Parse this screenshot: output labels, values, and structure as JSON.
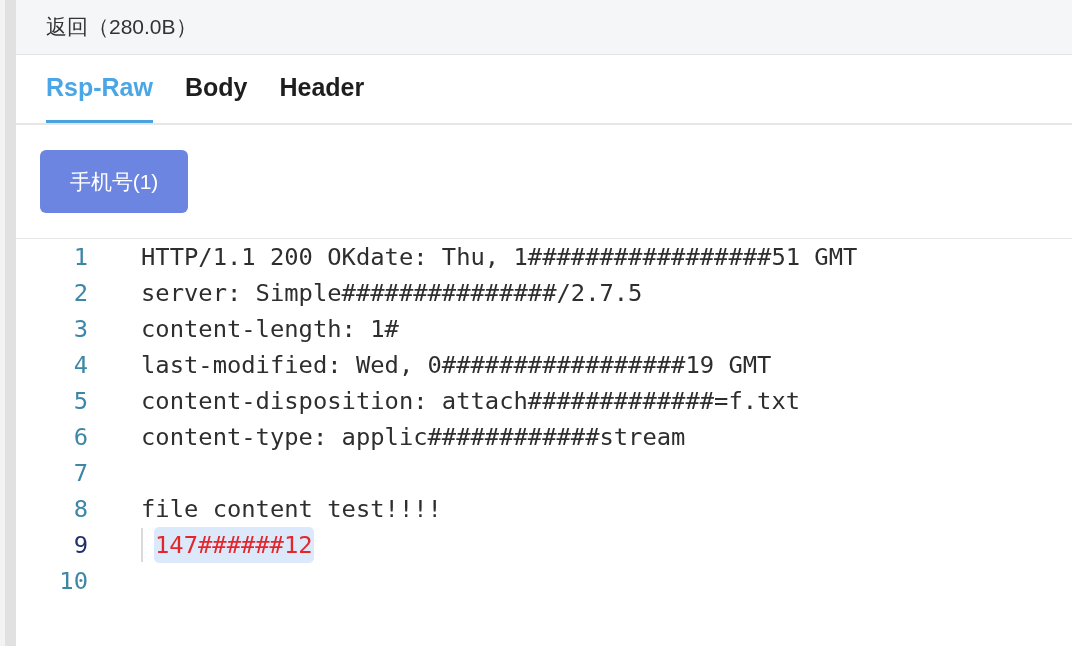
{
  "header": {
    "title": "返回（280.0B）"
  },
  "tabs": [
    {
      "label": "Rsp-Raw",
      "selected": true
    },
    {
      "label": "Body",
      "selected": false
    },
    {
      "label": "Header",
      "selected": false
    }
  ],
  "filters": [
    {
      "label": "手机号(1)"
    }
  ],
  "editor": {
    "lines": [
      {
        "number": "1",
        "kind": "plain",
        "text": "HTTP/1.1 200 OKdate: Thu, 1#################51 GMT",
        "active": false
      },
      {
        "number": "2",
        "kind": "plain",
        "text": "server: Simple###############/2.7.5",
        "active": false
      },
      {
        "number": "3",
        "kind": "plain",
        "text": "content-length: 1#",
        "active": false
      },
      {
        "number": "4",
        "kind": "plain",
        "text": "last-modified: Wed, 0#################19 GMT",
        "active": false
      },
      {
        "number": "5",
        "kind": "plain",
        "text": "content-disposition: attach#############=f.txt",
        "active": false
      },
      {
        "number": "6",
        "kind": "plain",
        "text": "content-type: applic############stream",
        "active": false
      },
      {
        "number": "7",
        "kind": "blank",
        "active": false
      },
      {
        "number": "8",
        "kind": "plain",
        "text": "file content test!!!!",
        "active": false
      },
      {
        "number": "9",
        "kind": "match",
        "text": "147######12",
        "active": true
      },
      {
        "number": "10",
        "kind": "blank",
        "active": false
      }
    ]
  }
}
